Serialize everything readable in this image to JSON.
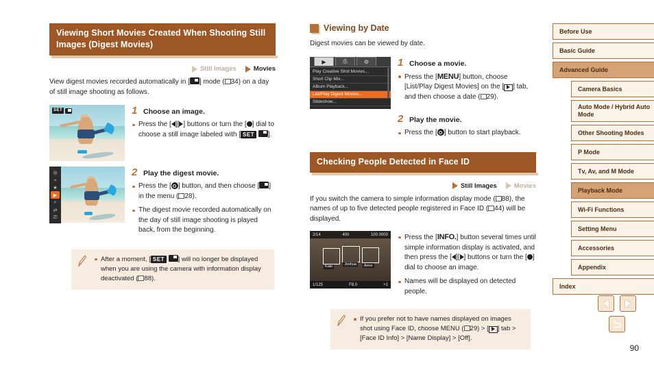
{
  "left_column": {
    "heading": "Viewing Short Movies Created When Shooting Still Images (Digest Movies)",
    "tags": {
      "still": "Still Images",
      "movies": "Movies"
    },
    "intro_a": "View digest movies recorded automatically in [",
    "intro_b": "] mode (",
    "intro_c": "34) on a day of still image shooting as follows.",
    "step1": {
      "num": "1",
      "title": "Choose an image.",
      "bullet_a": "Press the [",
      "bullet_b": "][",
      "bullet_c": "] buttons or turn the [",
      "bullet_d": "] dial to choose a still image labeled with [",
      "set_label": "SET",
      "bullet_e": "]."
    },
    "step2": {
      "num": "2",
      "title": "Play the digest movie.",
      "b1_a": "Press the [",
      "b1_b": "] button, and then choose [",
      "b1_c": "] in the menu (",
      "b1_d": "28).",
      "b2": "The digest movie recorded automatically on the day of still image shooting is played back, from the beginning."
    },
    "note": {
      "a": "After a moment, [",
      "set_label": "SET",
      "b": "] will no longer be displayed when you are using the camera with information display deactivated (",
      "c": "88)."
    }
  },
  "mid_column": {
    "section1": {
      "heading": "Viewing by Date",
      "intro": "Digest movies can be viewed by date.",
      "menu_screen": {
        "tabs": [
          "play",
          "print",
          "settings"
        ],
        "items": [
          "Play Creative Shot Movies...",
          "Short Clip Mix...",
          "Album Playback...",
          "List/Play Digest Movies...",
          "Slideshow..."
        ],
        "selected_index": 3
      },
      "step1": {
        "num": "1",
        "title": "Choose a movie.",
        "b_a": "Press the [",
        "menu_label": "MENU",
        "b_b": "] button, choose [List/Play Digest Movies] on the [",
        "b_c": "] tab, and then choose a date (",
        "b_d": "29)."
      },
      "step2": {
        "num": "2",
        "title": "Play the movie.",
        "b_a": "Press the [",
        "b_b": "] button to start playback."
      }
    },
    "section2": {
      "heading": "Checking People Detected in Face ID",
      "tags": {
        "still": "Still Images",
        "movies": "Movies"
      },
      "intro_a": "If you switch the camera to simple information display mode (",
      "intro_b": "88), the names of up to five detected people registered in Face ID (",
      "intro_c": "44) will be displayed.",
      "face_screen": {
        "counter": "2/14",
        "iso": "400",
        "size": "100 0000",
        "shutter": "1/125",
        "aperture": "F8.0",
        "exp": "+1",
        "names": [
          "Kate",
          "Joshua",
          "Anne"
        ]
      },
      "b1_a": "Press the [",
      "info_label": "INFO.",
      "b1_b": "] button several times until simple information display is activated, and then press the [",
      "b1_c": "][",
      "b1_d": "] buttons or turn the [",
      "b1_e": "] dial to choose an image.",
      "b2": "Names will be displayed on detected people.",
      "note": {
        "a": "If you prefer not to have names displayed on images shot using Face ID, choose MENU (",
        "b": "29) > [",
        "c": "] tab > [Face ID Info] > [Name Display] > [Off]."
      }
    }
  },
  "sidebar": {
    "items": [
      {
        "label": "Before Use",
        "level": 0,
        "active": false
      },
      {
        "label": "Basic Guide",
        "level": 0,
        "active": false
      },
      {
        "label": "Advanced Guide",
        "level": 0,
        "active": true
      },
      {
        "label": "Camera Basics",
        "level": 1,
        "active": false
      },
      {
        "label": "Auto Mode / Hybrid Auto Mode",
        "level": 1,
        "active": false
      },
      {
        "label": "Other Shooting Modes",
        "level": 1,
        "active": false
      },
      {
        "label": "P Mode",
        "level": 1,
        "active": false
      },
      {
        "label": "Tv, Av, and M Mode",
        "level": 1,
        "active": false
      },
      {
        "label": "Playback Mode",
        "level": 1,
        "active": true
      },
      {
        "label": "Wi-Fi Functions",
        "level": 1,
        "active": false
      },
      {
        "label": "Setting Menu",
        "level": 1,
        "active": false
      },
      {
        "label": "Accessories",
        "level": 1,
        "active": false
      },
      {
        "label": "Appendix",
        "level": 1,
        "active": false
      },
      {
        "label": "Index",
        "level": 0,
        "active": false
      }
    ]
  },
  "footer": {
    "prev_icon": "left-arrow-icon",
    "next_icon": "right-arrow-icon",
    "home_icon": "return-home-icon",
    "page_number": "90"
  },
  "colors": {
    "accent": "#9c5724",
    "accent_light": "#b5703a",
    "nav_bg": "#fbf2e8",
    "nav_active": "#d4a274",
    "note_bg": "#f6ece1",
    "menu_select": "#ef6c1f"
  }
}
